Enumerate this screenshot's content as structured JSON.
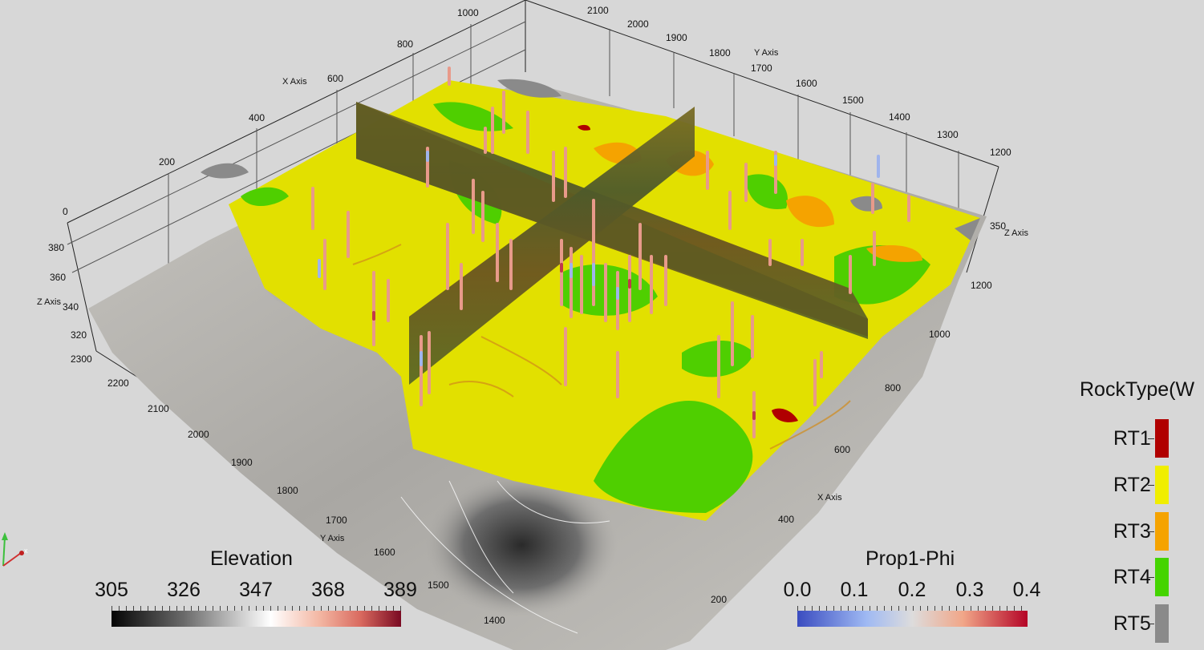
{
  "scene": {
    "x_axis_title": "X Axis",
    "y_axis_title": "Y Axis",
    "z_axis_title": "Z Axis",
    "x_ticks_top": [
      "0",
      "200",
      "400",
      "600",
      "800",
      "1000"
    ],
    "y_ticks_top": [
      "2100",
      "2000",
      "1900",
      "1800",
      "1700",
      "1600",
      "1500",
      "1400",
      "1300",
      "1200"
    ],
    "z_ticks_left": [
      "380",
      "360",
      "340",
      "320"
    ],
    "z_tick_right": "350",
    "y_ticks_left": [
      "2300",
      "2200",
      "2100",
      "2000",
      "1900",
      "1800",
      "1700",
      "1600",
      "1500",
      "1400"
    ],
    "x_ticks_right": [
      "1200",
      "1000",
      "800",
      "600",
      "400",
      "200"
    ]
  },
  "elevation_legend": {
    "title": "Elevation",
    "ticks": [
      "305",
      "326",
      "347",
      "368",
      "389"
    ],
    "colormap": "grayscale-to-red"
  },
  "phi_legend": {
    "title": "Prop1-Phi",
    "ticks": [
      "0.0",
      "0.1",
      "0.2",
      "0.3",
      "0.4"
    ],
    "colormap": "cool-warm"
  },
  "rocktype_legend": {
    "title": "RockType(W",
    "items": [
      {
        "label": "RT1",
        "color": "#b00000"
      },
      {
        "label": "RT2",
        "color": "#f0ee00"
      },
      {
        "label": "RT3",
        "color": "#f5a300"
      },
      {
        "label": "RT4",
        "color": "#44d400"
      },
      {
        "label": "RT5",
        "color": "#8a8a8a"
      }
    ]
  },
  "colors": {
    "background": "#d7d7d7",
    "layer_yellow": "#e2e000",
    "layer_green": "#4fcf00",
    "section_brown": "#6b5a1e"
  }
}
